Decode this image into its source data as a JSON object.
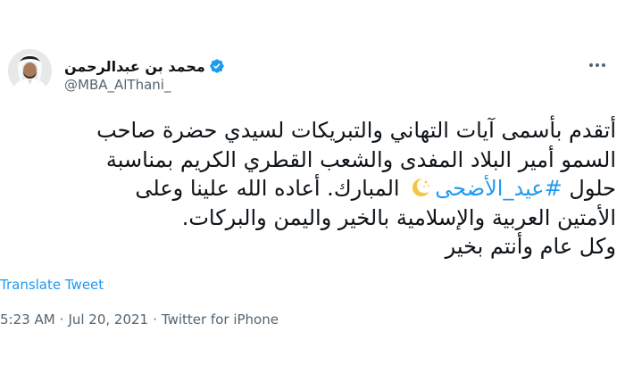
{
  "author": {
    "display_name": "محمد بن عبدالرحمن",
    "handle": "@MBA_AlThani_",
    "verified": true
  },
  "tweet": {
    "line1": "أتقدم بأسمى آيات التهاني والتبريكات لسيدي حضرة صاحب",
    "line2": "السمو أمير البلاد المفدى والشعب القطري الكريم بمناسبة",
    "line3_before": "حلول",
    "hashtag": "#عيد_الأضحى",
    "line3_after": "المبارك. أعاده الله علينا وعلى",
    "line4": "الأمتين العربية والإسلامية بالخير واليمن والبركات.",
    "line5": "وكل عام وأنتم بخير"
  },
  "translate_label": "Translate Tweet",
  "meta": {
    "time": "5:23 AM",
    "sep1": "·",
    "date": "Jul 20, 2021",
    "sep2": "·",
    "source": "Twitter for iPhone"
  },
  "colors": {
    "link": "#1d9bf0",
    "secondary": "#536471",
    "verified": "#1d9bf0"
  },
  "icons": {
    "verified": "verified-badge-icon",
    "more": "more-dots-icon",
    "emoji": "crescent-moon-stars-emoji"
  }
}
